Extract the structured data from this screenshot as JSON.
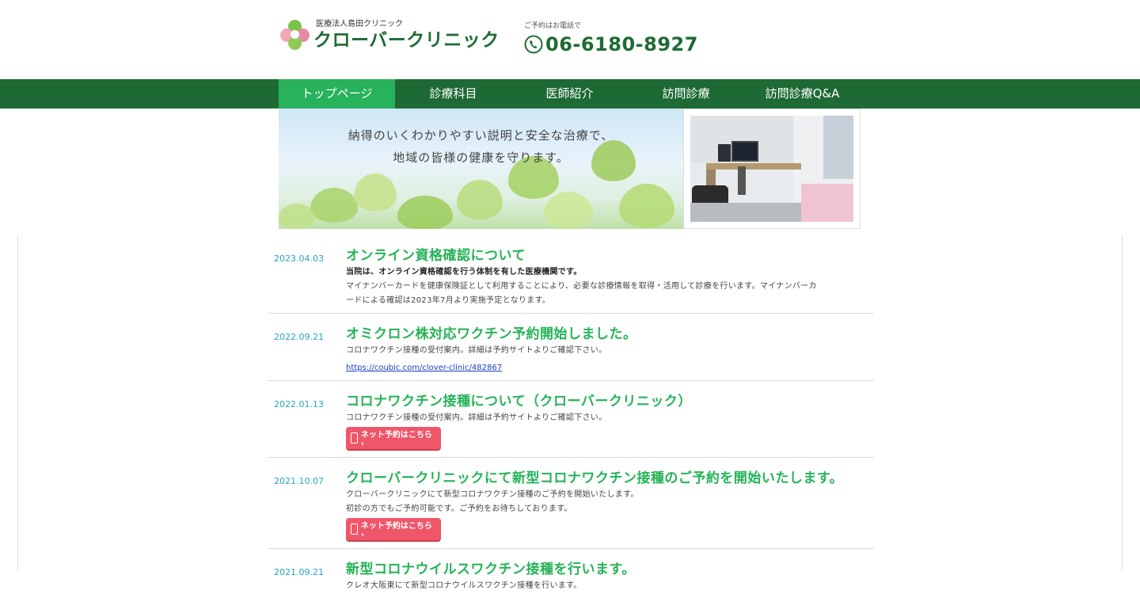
{
  "header": {
    "logo_sub": "医療法人島田クリニック",
    "logo_main": "クローバークリニック",
    "tel_label": "ご予約はお電話で",
    "tel_number": "06-6180-8927"
  },
  "nav": {
    "items": [
      {
        "label": "トップページ",
        "active": true
      },
      {
        "label": "診療科目"
      },
      {
        "label": "医師紹介"
      },
      {
        "label": "訪問診療"
      },
      {
        "label": "訪問診療Q&A"
      }
    ]
  },
  "hero": {
    "line1": "納得のいくわかりやすい説明と安全な治療で、",
    "line2": "地域の皆様の健康を守ります。"
  },
  "news": [
    {
      "date": "2023.04.03",
      "title": "オンライン資格確認について",
      "bold": "当院は、オンライン資格確認を行う体制を有した医療機関です。",
      "text1": "マイナンバーカードを健康保険証として利用することにより、必要な診療情報を取得・活用して診療を行います。マイナンバーカ",
      "text2": "ードによる確認は2023年7月より実施予定となります。"
    },
    {
      "date": "2022.09.21",
      "title": "オミクロン株対応ワクチン予約開始しました。",
      "text1": "コロナワクチン接種の受付案内。詳細は予約サイトよりご確認下さい。",
      "link": "https://coubic.com/clover-clinic/482867"
    },
    {
      "date": "2022.01.13",
      "title": "コロナワクチン接種について（クローバークリニック）",
      "text1": "コロナワクチン接種の受付案内。詳細は予約サイトよりご確認下さい。",
      "button": "ネット予約はこちら ›"
    },
    {
      "date": "2021.10.07",
      "title": "クローバークリニックにて新型コロナワクチン接種のご予約を開始いたします。",
      "text1": "クローバークリニックにて新型コロナワクチン接種のご予約を開始いたします。",
      "text2": "初診の方でもご予約可能です。ご予約をお待ちしております。",
      "button": "ネット予約はこちら ›"
    },
    {
      "date": "2021.09.21",
      "title": "新型コロナウイルスワクチン接種を行います。",
      "text1": "クレオ大阪東にて新型コロナウイルスワクチン接種を行います。"
    }
  ],
  "colors": {
    "brand_green": "#1d6a34",
    "nav_active": "#27b25b",
    "title_green": "#24b356",
    "date_blue": "#27a4c7",
    "button_red": "#f0566a"
  }
}
